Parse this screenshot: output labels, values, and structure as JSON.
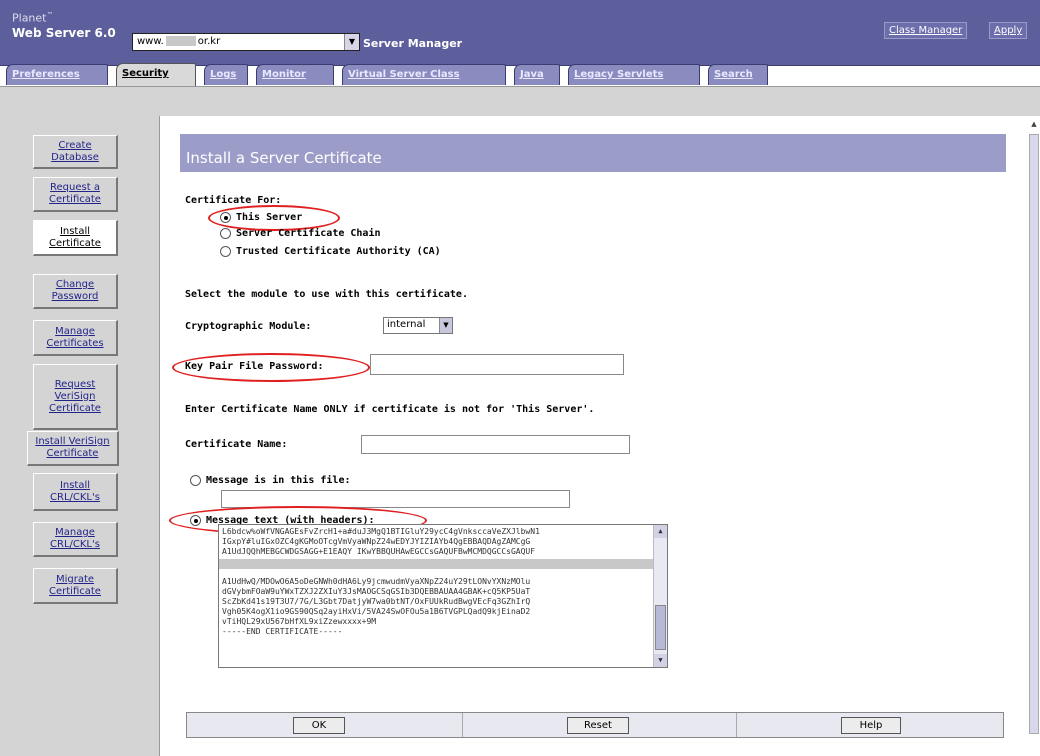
{
  "header": {
    "brand_line1": "Planet",
    "brand_tm": "™",
    "brand_line2": "Web Server 6.0",
    "server_prefix": "www.",
    "server_suffix": "or.kr",
    "server_manager_label": "Server Manager",
    "class_manager": "Class Manager",
    "apply": "Apply"
  },
  "tabs": [
    {
      "label": "Preferences"
    },
    {
      "label": "Security"
    },
    {
      "label": "Logs"
    },
    {
      "label": "Monitor"
    },
    {
      "label": "Virtual Server Class"
    },
    {
      "label": "Java"
    },
    {
      "label": "Legacy Servlets"
    },
    {
      "label": "Search"
    }
  ],
  "sidebar": {
    "items": [
      {
        "label": "Create Database"
      },
      {
        "label": "Request a Certificate"
      },
      {
        "label": "Install Certificate"
      },
      {
        "label": "Change Password"
      },
      {
        "label": "Manage Certificates"
      },
      {
        "label": "Request VeriSign Certificate"
      },
      {
        "label": "Install VeriSign Certificate"
      },
      {
        "label": "Install CRL/CKL's"
      },
      {
        "label": "Manage CRL/CKL's"
      },
      {
        "label": "Migrate Certificate"
      }
    ]
  },
  "main": {
    "title": "Install a Server Certificate",
    "certificate_for_label": "Certificate For:",
    "options": {
      "this_server": "This Server",
      "chain": "Server Certificate Chain",
      "ca": "Trusted Certificate Authority (CA)"
    },
    "select_module_text": "Select the module to use with this certificate.",
    "crypto_module_label": "Cryptographic Module:",
    "crypto_module_value": "internal",
    "key_pair_label": "Key Pair File Password:",
    "enter_cert_name_text": "Enter Certificate Name ONLY if certificate is not for 'This Server'.",
    "cert_name_label": "Certificate Name:",
    "message_file_label": "Message is in this file:",
    "message_text_label": "Message text (with headers):",
    "message_lines": [
      "L6bdcw%oWfVNGAGEsFvZrcH1+a#duJ3MgQ1BTIGluY29ycC4gVnksccaVeZXJlbwN1",
      "IGxpY#luIGxOZC4gKGMoOTcgVmVyaWNpZ24wEDYJYIZIAYb4QgEBBAQDAgZAMCgG",
      "A1UdJQQhMEBGCWDGSAGG+E1EAQY IKwYBBQUHAwEGCCsGAQUFBwMCMDQGCCsGAQUF",
      "",
      "A1UdHwQ/MDOwO6A5oDeGNWh0dHA6Ly9jcmwudmVyaXNpZ24uY29tLONvYXNzMOlu",
      "dGVybmFOaW9uYWxTZXJ2ZXIuY3JsMAOGCSqGSIb3DQEBBAUAA4GBAK+cQ5KP5UaT",
      "ScZbKd41s19T3U7/7G/L3Gbt7DatjyW7wa0btNT/OxFUUkRudBwgVEcFq3GZhIrQ",
      "Vgh05K4ogX1io9GS90QSq2ayiHxVi/5VA24SwOFOu5a1B6TVGPLQadQ9kjEinaD2",
      "vTiHQL29xU567bHfXL9xiZzewxxxx+9M",
      "-----END CERTIFICATE-----"
    ]
  },
  "buttons": {
    "ok": "OK",
    "reset": "Reset",
    "help": "Help"
  }
}
